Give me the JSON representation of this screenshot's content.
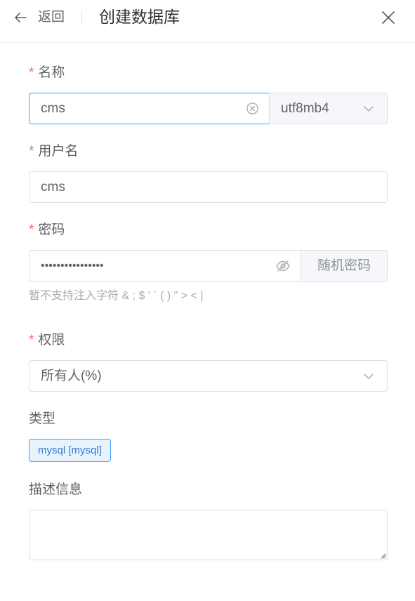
{
  "header": {
    "back_label": "返回",
    "title": "创建数据库"
  },
  "form": {
    "required_mark": "*",
    "name": {
      "label": "名称",
      "value": "cms",
      "charset": "utf8mb4"
    },
    "username": {
      "label": "用户名",
      "value": "cms"
    },
    "password": {
      "label": "密码",
      "value_masked": "••••••••••••••••",
      "random_button": "随机密码",
      "hint": "暂不支持注入字符 & ; $ ' ` ( ) \" > < |"
    },
    "permission": {
      "label": "权限",
      "value": "所有人(%)"
    },
    "type": {
      "label": "类型",
      "tag": "mysql [mysql]"
    },
    "description": {
      "label": "描述信息",
      "value": ""
    }
  },
  "colors": {
    "accent": "#409eff",
    "required": "#f56c6c",
    "tag_bg": "#e8f2fd",
    "tag_text": "#337ecc"
  },
  "icons": {
    "back": "arrow-left-icon",
    "close": "close-icon",
    "clear": "circle-close-icon",
    "chevron": "chevron-down-icon",
    "eye": "eye-hidden-icon"
  }
}
